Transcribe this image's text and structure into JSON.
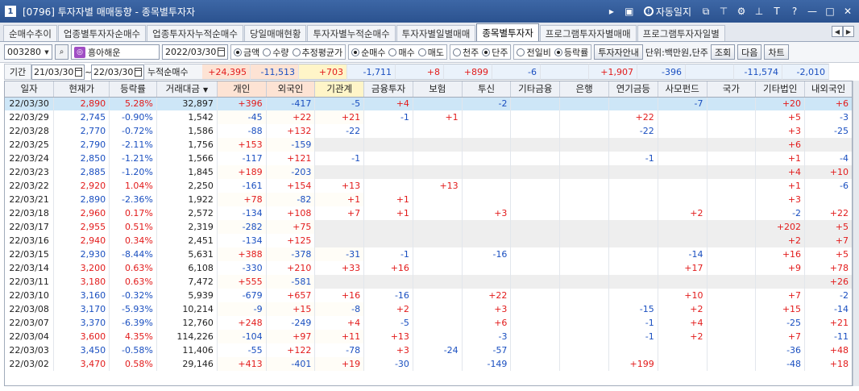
{
  "window": {
    "num": "1",
    "title": "[0796] 투자자별 매매동향 - 종목별투자자",
    "auto_journal": "자동일지",
    "icons": [
      "arrow-right-icon",
      "screen-icon",
      "info-icon",
      "link-icon",
      "pin-icon",
      "settings-icon",
      "pin-icon",
      "font-icon",
      "help-icon",
      "minimize-icon",
      "maximize-icon",
      "close-icon"
    ]
  },
  "tabs": [
    {
      "label": "순매수추이",
      "active": false
    },
    {
      "label": "업종별투자자순매수",
      "active": false
    },
    {
      "label": "업종투자자누적순매수",
      "active": false
    },
    {
      "label": "당일매매현황",
      "active": false
    },
    {
      "label": "투자자별누적순매수",
      "active": false
    },
    {
      "label": "투자자별일별매매",
      "active": false
    },
    {
      "label": "종목별투자자",
      "active": true
    },
    {
      "label": "프로그램투자자별매매",
      "active": false
    },
    {
      "label": "프로그램투자자일별",
      "active": false
    }
  ],
  "toolbar": {
    "code": "003280",
    "stock_name": "흥아해운",
    "date": "2022/03/30",
    "radios1": [
      {
        "label": "금액",
        "on": true
      },
      {
        "label": "수량",
        "on": false
      },
      {
        "label": "추정평균가",
        "on": false
      }
    ],
    "radios2": [
      {
        "label": "순매수",
        "on": true
      },
      {
        "label": "매수",
        "on": false
      },
      {
        "label": "매도",
        "on": false
      }
    ],
    "radios3": [
      {
        "label": "천주",
        "on": false
      },
      {
        "label": "단주",
        "on": true
      }
    ],
    "radios4": [
      {
        "label": "전일비",
        "on": false
      },
      {
        "label": "등락률",
        "on": true
      }
    ],
    "guide_btn": "투자자안내",
    "unit": "단위:백만원,단주",
    "query_btn": "조회",
    "next_btn": "다음",
    "chart_btn": "차트"
  },
  "period": {
    "label": "기간",
    "from": "21/03/30",
    "to": "22/03/30",
    "sep": "~",
    "sum_label": "누적순매수",
    "sums": [
      "+24,395",
      "-11,513",
      "+703",
      "-1,711",
      "+8",
      "+899",
      "-6",
      "",
      "+1,907",
      "-396",
      "",
      "-11,574",
      "-2,010"
    ]
  },
  "columns": [
    "일자",
    "현재가",
    "등락률",
    "거래대금",
    "개인",
    "외국인",
    "기관계",
    "금융투자",
    "보험",
    "투신",
    "기타금융",
    "은행",
    "연기금등",
    "사모펀드",
    "국가",
    "기타법인",
    "내외국인"
  ],
  "rows": [
    [
      "22/03/30",
      "2,890",
      "5.28%",
      "32,897",
      "+396",
      "-417",
      "-5",
      "+4",
      "",
      "-2",
      "",
      "",
      "",
      "-7",
      "",
      "+20",
      "+6"
    ],
    [
      "22/03/29",
      "2,745",
      "-0.90%",
      "1,542",
      "-45",
      "+22",
      "+21",
      "-1",
      "+1",
      "",
      "",
      "",
      "+22",
      "",
      "",
      "+5",
      "-3"
    ],
    [
      "22/03/28",
      "2,770",
      "-0.72%",
      "1,586",
      "-88",
      "+132",
      "-22",
      "",
      "",
      "",
      "",
      "",
      "-22",
      "",
      "",
      "+3",
      "-25"
    ],
    [
      "22/03/25",
      "2,790",
      "-2.11%",
      "1,756",
      "+153",
      "-159",
      "",
      "",
      "",
      "",
      "",
      "",
      "",
      "",
      "",
      "+6",
      ""
    ],
    [
      "22/03/24",
      "2,850",
      "-1.21%",
      "1,566",
      "-117",
      "+121",
      "-1",
      "",
      "",
      "",
      "",
      "",
      "-1",
      "",
      "",
      "+1",
      "-4"
    ],
    [
      "22/03/23",
      "2,885",
      "-1.20%",
      "1,845",
      "+189",
      "-203",
      "",
      "",
      "",
      "",
      "",
      "",
      "",
      "",
      "",
      "+4",
      "+10"
    ],
    [
      "22/03/22",
      "2,920",
      "1.04%",
      "2,250",
      "-161",
      "+154",
      "+13",
      "",
      "+13",
      "",
      "",
      "",
      "",
      "",
      "",
      "+1",
      "-6"
    ],
    [
      "22/03/21",
      "2,890",
      "-2.36%",
      "1,922",
      "+78",
      "-82",
      "+1",
      "+1",
      "",
      "",
      "",
      "",
      "",
      "",
      "",
      "+3",
      ""
    ],
    [
      "22/03/18",
      "2,960",
      "0.17%",
      "2,572",
      "-134",
      "+108",
      "+7",
      "+1",
      "",
      "+3",
      "",
      "",
      "",
      "+2",
      "",
      "-2",
      "+22"
    ],
    [
      "22/03/17",
      "2,955",
      "0.51%",
      "2,319",
      "-282",
      "+75",
      "",
      "",
      "",
      "",
      "",
      "",
      "",
      "",
      "",
      "+202",
      "+5"
    ],
    [
      "22/03/16",
      "2,940",
      "0.34%",
      "2,451",
      "-134",
      "+125",
      "",
      "",
      "",
      "",
      "",
      "",
      "",
      "",
      "",
      "+2",
      "+7"
    ],
    [
      "22/03/15",
      "2,930",
      "-8.44%",
      "5,631",
      "+388",
      "-378",
      "-31",
      "-1",
      "",
      "-16",
      "",
      "",
      "",
      "-14",
      "",
      "+16",
      "+5"
    ],
    [
      "22/03/14",
      "3,200",
      "0.63%",
      "6,108",
      "-330",
      "+210",
      "+33",
      "+16",
      "",
      "",
      "",
      "",
      "",
      "+17",
      "",
      "+9",
      "+78"
    ],
    [
      "22/03/11",
      "3,180",
      "0.63%",
      "7,472",
      "+555",
      "-581",
      "",
      "",
      "",
      "",
      "",
      "",
      "",
      "",
      "",
      "",
      "+26"
    ],
    [
      "22/03/10",
      "3,160",
      "-0.32%",
      "5,939",
      "-679",
      "+657",
      "+16",
      "-16",
      "",
      "+22",
      "",
      "",
      "",
      "+10",
      "",
      "+7",
      "-2"
    ],
    [
      "22/03/08",
      "3,170",
      "-5.93%",
      "10,214",
      "-9",
      "+15",
      "-8",
      "+2",
      "",
      "+3",
      "",
      "",
      "-15",
      "+2",
      "",
      "+15",
      "-14"
    ],
    [
      "22/03/07",
      "3,370",
      "-6.39%",
      "12,760",
      "+248",
      "-249",
      "+4",
      "-5",
      "",
      "+6",
      "",
      "",
      "-1",
      "+4",
      "",
      "-25",
      "+21"
    ],
    [
      "22/03/04",
      "3,600",
      "4.35%",
      "114,226",
      "-104",
      "+97",
      "+11",
      "+13",
      "",
      "-3",
      "",
      "",
      "-1",
      "+2",
      "",
      "+7",
      "-11"
    ],
    [
      "22/03/03",
      "3,450",
      "-0.58%",
      "11,406",
      "-55",
      "+122",
      "-78",
      "+3",
      "-24",
      "-57",
      "",
      "",
      "",
      "",
      "",
      "-36",
      "+48"
    ],
    [
      "22/03/02",
      "3,470",
      "0.58%",
      "29,146",
      "+413",
      "-401",
      "+19",
      "-30",
      "",
      "-149",
      "",
      "",
      "+199",
      "",
      "",
      "-48",
      "+18"
    ]
  ],
  "price_colors": {
    "up": "#e21b1b",
    "down": "#1a4fc0"
  }
}
